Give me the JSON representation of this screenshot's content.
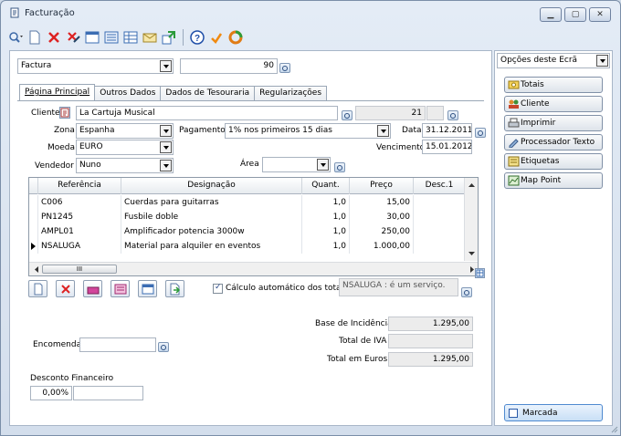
{
  "window": {
    "title": "Facturação"
  },
  "header": {
    "doc_type": "Factura",
    "doc_number": "90"
  },
  "tabs": [
    {
      "label": "Página Principal",
      "active": true
    },
    {
      "label": "Outros Dados"
    },
    {
      "label": "Dados de Tesouraria"
    },
    {
      "label": "Regularizações"
    }
  ],
  "form": {
    "cliente_label": "Cliente",
    "cliente_value": "La Cartuja Musical",
    "cliente_code": "21",
    "zona_label": "Zona",
    "zona_value": "Espanha",
    "pagamento_label": "Pagamento",
    "pagamento_value": "1% nos primeiros 15 dias",
    "data_label": "Data",
    "data_value": "31.12.2011",
    "moeda_label": "Moeda",
    "moeda_value": "EURO",
    "vencimento_label": "Vencimento",
    "vencimento_value": "15.01.2012",
    "vendedor_label": "Vendedor",
    "vendedor_value": "Nuno",
    "area_label": "Área",
    "area_value": ""
  },
  "grid": {
    "columns": [
      "Referência",
      "Designação",
      "Quant.",
      "Preço",
      "Desc.1"
    ],
    "rows": [
      {
        "ref": "C006",
        "des": "Cuerdas para guitarras",
        "qty": "1,0",
        "price": "15,00"
      },
      {
        "ref": "PN1245",
        "des": "Fusbile doble",
        "qty": "1,0",
        "price": "30,00"
      },
      {
        "ref": "AMPL01",
        "des": "Amplificador potencia 3000w",
        "qty": "1,0",
        "price": "250,00"
      },
      {
        "ref": "NSALUGA",
        "des": "Material para alquiler en eventos",
        "qty": "1,0",
        "price": "1.000,00"
      }
    ],
    "hscroll_grip": "III"
  },
  "calc": {
    "auto_label": "Cálculo automático dos totais",
    "auto_checked": true,
    "info_text": "NSALUGA : é um serviço."
  },
  "totals": {
    "base_label": "Base de Incidência",
    "base_value": "1.295,00",
    "iva_label": "Total de IVA",
    "iva_value": "",
    "total_label": "Total em Euros",
    "total_value": "1.295,00"
  },
  "encomenda": {
    "label": "Encomenda",
    "value": ""
  },
  "desconto": {
    "label": "Desconto Financeiro",
    "value": "0,00%",
    "amount": ""
  },
  "sidebar": {
    "options_label": "Opções deste Ecrã",
    "buttons": [
      "Totais",
      "Cliente",
      "Imprimir",
      "Processador Texto",
      "Etiquetas",
      "Map Point"
    ],
    "bottom_button": "Marcada"
  },
  "colors": {
    "accent": "#2a5aa8",
    "window_bg": "#d3deec",
    "border": "#a8b6c8"
  }
}
